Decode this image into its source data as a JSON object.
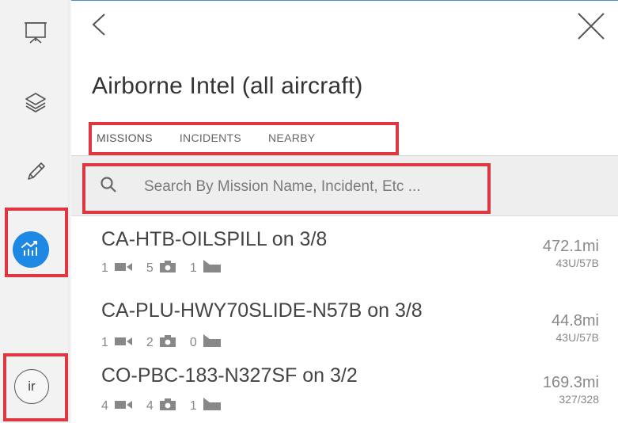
{
  "sidebar": {
    "items": [
      {
        "name": "presentation",
        "icon": "presentation-board-icon"
      },
      {
        "name": "layers",
        "icon": "layers-icon"
      },
      {
        "name": "draw",
        "icon": "pencil-icon"
      },
      {
        "name": "analytics",
        "icon": "analytics-chart-icon",
        "active": true,
        "color": "#1e88e5"
      }
    ],
    "avatar_initials": "ir"
  },
  "header": {
    "title": "Airborne Intel (all aircraft)"
  },
  "tabs": [
    {
      "label": "MISSIONS",
      "active": true
    },
    {
      "label": "INCIDENTS",
      "active": false
    },
    {
      "label": "NEARBY",
      "active": false
    }
  ],
  "search": {
    "placeholder": "Search By Mission Name, Incident, Etc ..."
  },
  "missions": [
    {
      "name": "CA-HTB-OILSPILL on 3/8",
      "videos": "1",
      "photos": "5",
      "reports": "1",
      "distance": "472.1mi",
      "ratio": "43U/57B"
    },
    {
      "name": "CA-PLU-HWY70SLIDE-N57B on 3/8",
      "videos": "1",
      "photos": "2",
      "reports": "0",
      "distance": "44.8mi",
      "ratio": "43U/57B"
    },
    {
      "name": "CO-PBC-183-N327SF on 3/2",
      "videos": "4",
      "photos": "4",
      "reports": "1",
      "distance": "169.3mi",
      "ratio": "327/328"
    }
  ],
  "colors": {
    "accent": "#1e88e5",
    "highlight": "#e0363f"
  }
}
